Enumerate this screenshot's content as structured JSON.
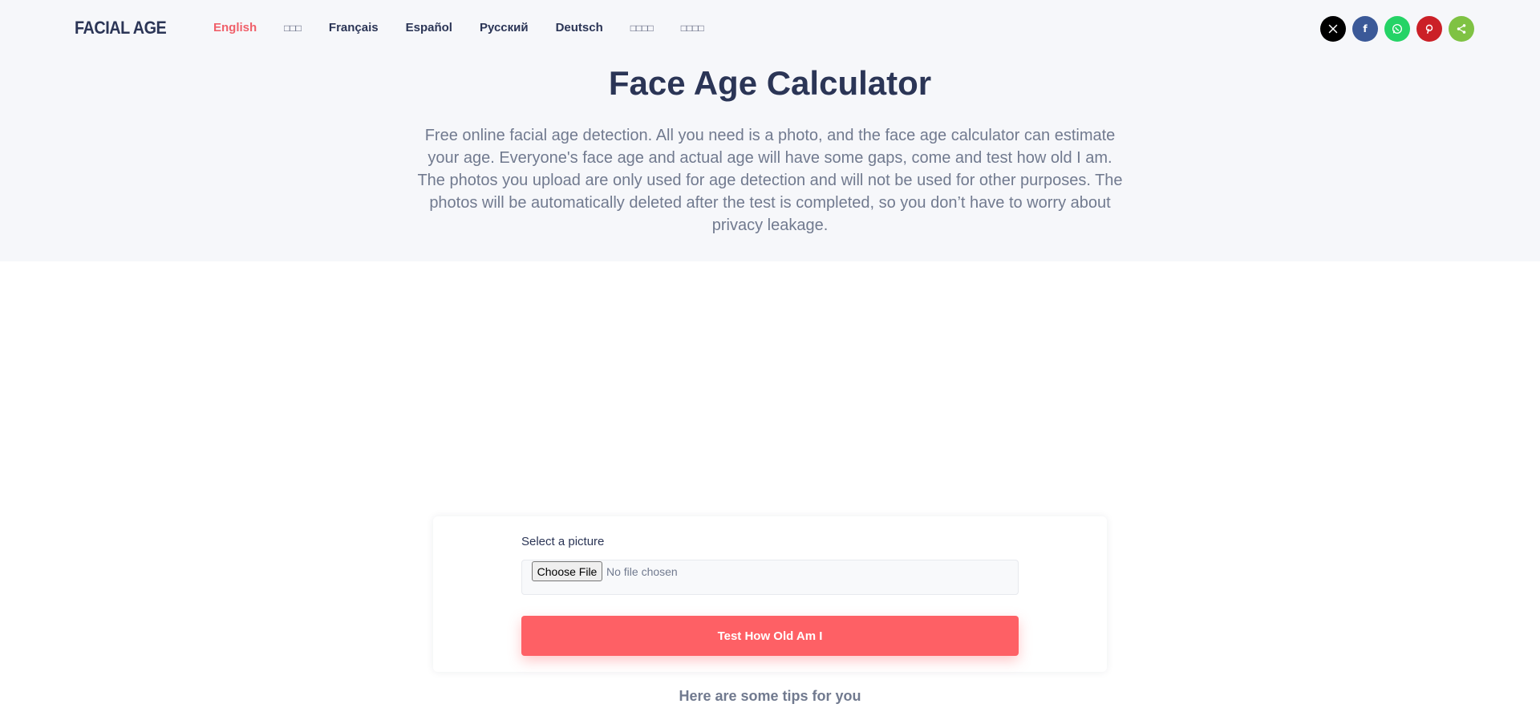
{
  "brand": {
    "logo": "FACIAL AGE"
  },
  "nav": {
    "languages": [
      {
        "label": "English",
        "active": true
      },
      {
        "label": "□□□",
        "active": false,
        "cjk": true
      },
      {
        "label": "Français",
        "active": false
      },
      {
        "label": "Español",
        "active": false
      },
      {
        "label": "Русский",
        "active": false
      },
      {
        "label": "Deutsch",
        "active": false
      },
      {
        "label": "□□□□",
        "active": false,
        "cjk": true
      },
      {
        "label": "□□□□",
        "active": false,
        "cjk": true
      }
    ]
  },
  "share": [
    {
      "icon": "x-icon",
      "color": "#000000",
      "glyph": "𝕏"
    },
    {
      "icon": "facebook-icon",
      "color": "#3b5998",
      "glyph": "f"
    },
    {
      "icon": "whatsapp-icon",
      "color": "#25d366",
      "glyph": "✆"
    },
    {
      "icon": "pinterest-icon",
      "color": "#cb2027",
      "glyph": "P"
    },
    {
      "icon": "share-icon",
      "color": "#7fc243",
      "glyph": "⤴"
    }
  ],
  "hero": {
    "title": "Face Age Calculator",
    "description": "Free online facial age detection. All you need is a photo, and the face age calculator can estimate your age. Everyone's face age and actual age will have some gaps, come and test how old I am. The photos you upload are only used for age detection and will not be used for other purposes. The photos will be automatically deleted after the test is completed, so you don’t have to worry about privacy leakage."
  },
  "form": {
    "label": "Select a picture",
    "file_button": "Choose File",
    "file_status": "No file chosen",
    "submit_label": "Test How Old Am I"
  },
  "tips": {
    "heading": "Here are some tips for you"
  },
  "colors": {
    "accent": "#fe6065",
    "nav_active": "#f0606a",
    "text_dark": "#2b3556",
    "text_muted": "#717a8f",
    "hero_bg": "#f6f7fa"
  }
}
